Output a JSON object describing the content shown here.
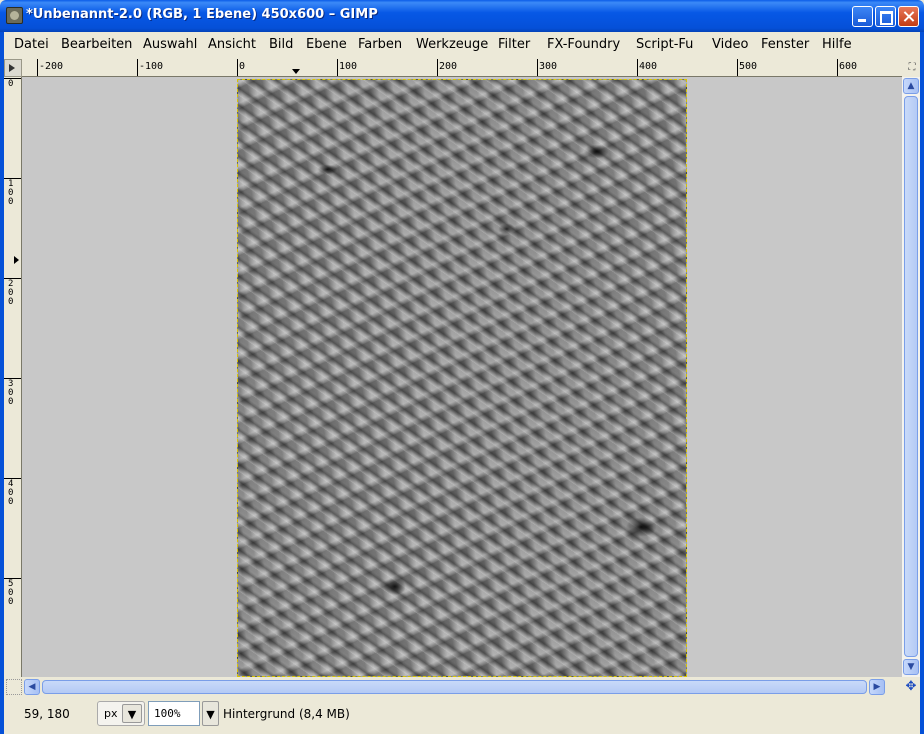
{
  "window": {
    "title": "*Unbenannt-2.0 (RGB, 1 Ebene) 450x600 – GIMP"
  },
  "menu": [
    "Datei",
    "Bearbeiten",
    "Auswahl",
    "Ansicht",
    "Bild",
    "Ebene",
    "Farben",
    "Werkzeuge",
    "Filter",
    "FX-Foundry",
    "Script-Fu",
    "Video",
    "Fenster",
    "Hilfe"
  ],
  "ruler_h": [
    "-200",
    "-100",
    "0",
    "100",
    "200",
    "300",
    "400",
    "500",
    "600"
  ],
  "ruler_v": [
    "0",
    "1\n0\n0",
    "2\n0\n0",
    "3\n0\n0",
    "4\n0\n0",
    "5\n0\n0"
  ],
  "status": {
    "coords": "59, 180",
    "unit": "px",
    "zoom": "100",
    "zoom_suffix": "%",
    "layer_info": "Hintergrund (8,4 MB)"
  },
  "icons": {
    "close": "close-icon",
    "maximize": "maximize-icon",
    "minimize": "minimize-icon",
    "navigate": "navigate-icon"
  }
}
